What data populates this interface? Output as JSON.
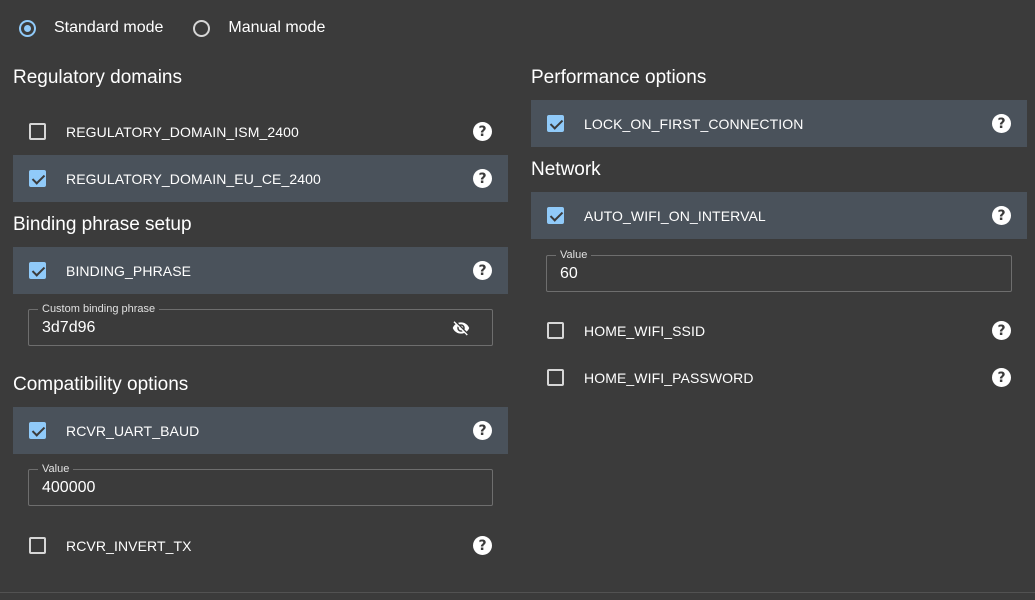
{
  "mode": {
    "standard_label": "Standard mode",
    "manual_label": "Manual mode",
    "selected": "standard"
  },
  "left": {
    "regulatory": {
      "title": "Regulatory domains",
      "items": [
        {
          "label": "REGULATORY_DOMAIN_ISM_2400",
          "checked": false
        },
        {
          "label": "REGULATORY_DOMAIN_EU_CE_2400",
          "checked": true
        }
      ]
    },
    "binding": {
      "title": "Binding phrase setup",
      "item": {
        "label": "BINDING_PHRASE",
        "checked": true
      },
      "field_label": "Custom binding phrase",
      "field_value": "3d7d96"
    },
    "compat": {
      "title": "Compatibility options",
      "baud": {
        "label": "RCVR_UART_BAUD",
        "checked": true
      },
      "field_label": "Value",
      "field_value": "400000",
      "invert": {
        "label": "RCVR_INVERT_TX",
        "checked": false
      }
    }
  },
  "right": {
    "performance": {
      "title": "Performance options",
      "item": {
        "label": "LOCK_ON_FIRST_CONNECTION",
        "checked": true
      }
    },
    "network": {
      "title": "Network",
      "auto_wifi": {
        "label": "AUTO_WIFI_ON_INTERVAL",
        "checked": true
      },
      "field_label": "Value",
      "field_value": "60",
      "ssid": {
        "label": "HOME_WIFI_SSID",
        "checked": false
      },
      "password": {
        "label": "HOME_WIFI_PASSWORD",
        "checked": false
      }
    }
  },
  "help_glyph": "?",
  "icons": {
    "help": "help-circle-icon",
    "visibility": "eye-off-icon"
  },
  "colors": {
    "background": "#3b3b3b",
    "selected_row": "#4a525b",
    "accent": "#90caf9"
  }
}
